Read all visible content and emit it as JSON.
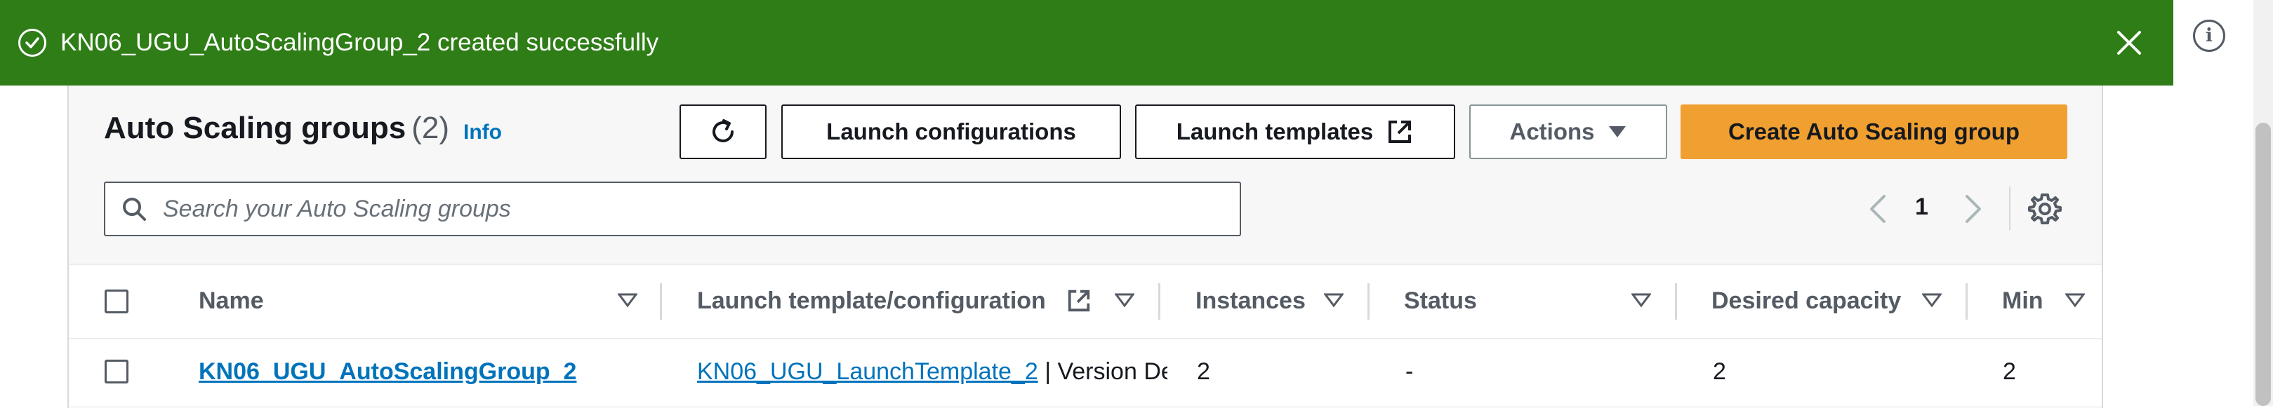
{
  "flash": {
    "message": "KN06_UGU_AutoScalingGroup_2 created successfully",
    "color": "#2e7d16"
  },
  "header": {
    "title": "Auto Scaling groups",
    "count": "(2)",
    "info_link": "Info"
  },
  "toolbar": {
    "launch_configurations_label": "Launch configurations",
    "launch_templates_label": "Launch templates",
    "actions_label": "Actions",
    "create_label": "Create Auto Scaling group",
    "accent_color": "#f0a031"
  },
  "search": {
    "placeholder": "Search your Auto Scaling groups",
    "value": ""
  },
  "pagination": {
    "current_page": "1"
  },
  "table": {
    "columns": [
      {
        "label": "Name"
      },
      {
        "label": "Launch template/configuration"
      },
      {
        "label": "Instances"
      },
      {
        "label": "Status"
      },
      {
        "label": "Desired capacity"
      },
      {
        "label": "Min"
      }
    ],
    "rows": [
      {
        "name": "KN06_UGU_AutoScalingGroup_2",
        "launch_template": "KN06_UGU_LaunchTemplate_2",
        "launch_template_suffix": " | Version Default",
        "instances": "2",
        "status": "-",
        "desired_capacity": "2",
        "min": "2"
      }
    ]
  },
  "icons": {
    "flash_status": "check-circle-icon",
    "flash_close": "close-icon",
    "help": "info-icon",
    "refresh": "refresh-icon",
    "external": "external-link-icon",
    "dropdown": "caret-down-icon",
    "search": "search-icon",
    "prev": "chevron-left-icon",
    "next": "chevron-right-icon",
    "settings": "gear-icon"
  }
}
